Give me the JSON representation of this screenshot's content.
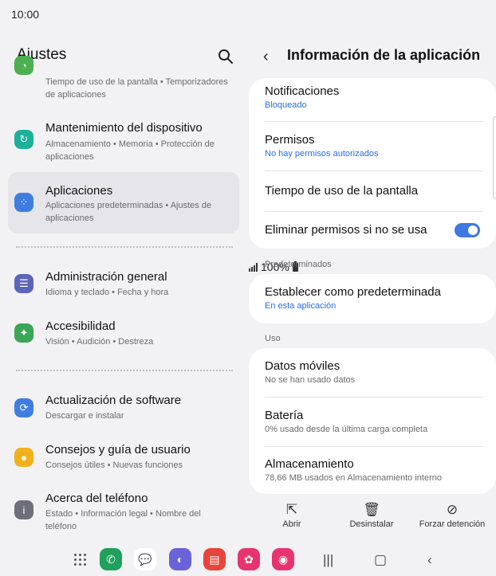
{
  "status": {
    "time": "10:00",
    "battery": "100%"
  },
  "left": {
    "title": "Ajustes",
    "items": [
      {
        "subtitle": "Tiempo de uso de la pantalla  •  Temporizadores de aplicaciones",
        "icon": "digital-wellbeing-icon",
        "color": "#4caf50"
      },
      {
        "title": "Mantenimiento del dispositivo",
        "subtitle": "Almacenamiento  •  Memoria  •  Protección de aplicaciones",
        "icon": "device-care-icon",
        "color": "#1db09a"
      },
      {
        "title": "Aplicaciones",
        "subtitle": "Aplicaciones predeterminadas  •  Ajustes de aplicaciones",
        "icon": "apps-icon",
        "color": "#3f7de0"
      },
      {
        "title": "Administración general",
        "subtitle": "Idioma y teclado  •  Fecha y hora",
        "icon": "sliders-icon",
        "color": "#5c64b8"
      },
      {
        "title": "Accesibilidad",
        "subtitle": "Visión  •  Audición  •  Destreza",
        "icon": "accessibility-icon",
        "color": "#3aa657"
      },
      {
        "title": "Actualización de software",
        "subtitle": "Descargar e instalar",
        "icon": "software-update-icon",
        "color": "#3f7de0"
      },
      {
        "title": "Consejos y guía de usuario",
        "subtitle": "Consejos útiles  •  Nuevas funciones",
        "icon": "bulb-icon",
        "color": "#f2b11c"
      },
      {
        "title": "Acerca del teléfono",
        "subtitle": "Estado  •  Información legal  •  Nombre del teléfono",
        "icon": "info-icon",
        "color": "#6d6f7a"
      }
    ]
  },
  "right": {
    "title": "Información de la aplicación",
    "notifications": {
      "title": "Notificaciones",
      "value": "Bloqueado"
    },
    "permissions": {
      "title": "Permisos",
      "value": "No hay permisos autorizados"
    },
    "screen_time": {
      "title": "Tiempo de uso de la pantalla"
    },
    "remove_permissions": {
      "title": "Eliminar permisos si no se usa",
      "enabled": true
    },
    "defaults_header": "Predeterminados",
    "set_default": {
      "title": "Establecer como predeterminada",
      "value": "En esta aplicación"
    },
    "usage_header": "Uso",
    "mobile_data": {
      "title": "Datos móviles",
      "value": "No se han usado datos"
    },
    "battery": {
      "title": "Batería",
      "value": "0% usado desde la última carga completa"
    },
    "storage": {
      "title": "Almacenamiento",
      "value": "78,66 MB usados en Almacenamiento interno"
    }
  },
  "actions": {
    "open": "Abrir",
    "uninstall": "Desinstalar",
    "force_stop": "Forzar detención"
  },
  "colors": {
    "accent": "#3e78e0",
    "link": "#2a6edb"
  }
}
